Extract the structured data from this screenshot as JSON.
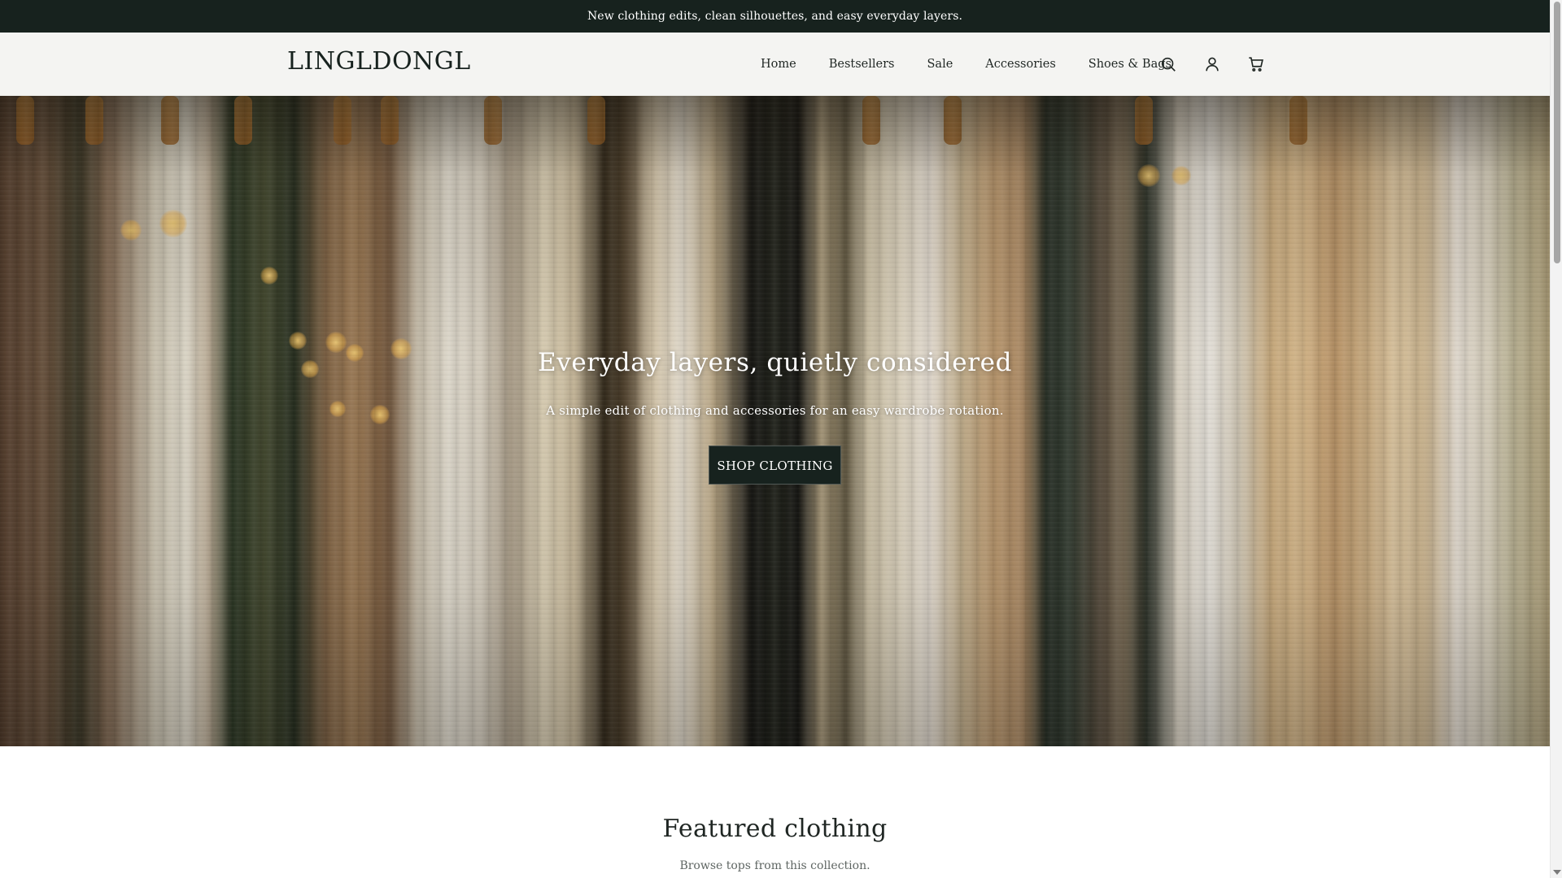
{
  "announcement": {
    "text": "New clothing edits, clean silhouettes, and easy everyday layers."
  },
  "header": {
    "logo": "LINGLDONGL",
    "nav": [
      {
        "label": "Home"
      },
      {
        "label": "Bestsellers"
      },
      {
        "label": "Sale"
      },
      {
        "label": "Accessories"
      },
      {
        "label": "Shoes & Bags"
      }
    ],
    "icons": [
      "search-icon",
      "account-icon",
      "cart-icon"
    ]
  },
  "hero": {
    "title": "Everyday layers, quietly considered",
    "subtitle": "A simple edit of clothing and accessories for an easy wardrobe rotation.",
    "cta": "SHOP CLOTHING"
  },
  "featured": {
    "title": "Featured clothing",
    "subtitle": "Browse tops from this collection."
  },
  "colors": {
    "announcement_bg": "#17221e",
    "header_bg": "#f4f4f2",
    "button_bg": "#17221e",
    "text": "#1f2623"
  }
}
